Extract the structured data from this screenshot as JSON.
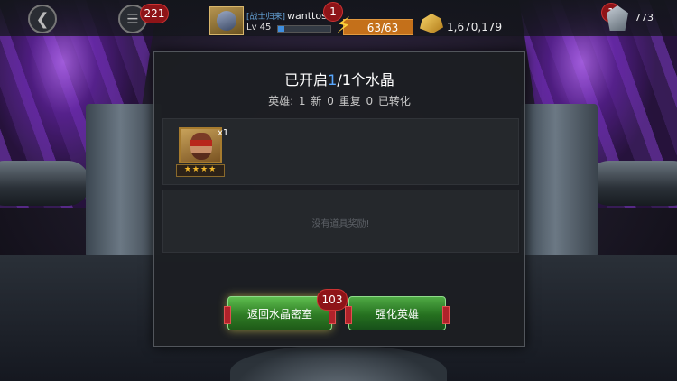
{
  "topbar": {
    "back_icon": "back-arrow-icon",
    "menu_icon": "menu-icon",
    "menu_badge": "221",
    "alliance_tag": "[战士归来]",
    "username": "wanttose",
    "notification_badge": "1",
    "level": "Lv 45",
    "xp_progress": 0.12,
    "energy": "63/63",
    "gold": "1,670,179",
    "units_badge": "1",
    "units": "773"
  },
  "dialog": {
    "title_prefix": "已开启",
    "title_highlight": "1",
    "title_suffix": "/1个水晶",
    "summary": "英雄:  1 新  0 重复  0 已转化",
    "hero": {
      "name_icon": "star-lord-portrait",
      "stars": "★★★★",
      "count": "x1"
    },
    "no_items_text": "没有道具奖励!",
    "back_button": "返回水晶密室",
    "back_badge": "103",
    "power_up_button": "强化英雄"
  },
  "colors": {
    "accent_blue": "#59a8ff",
    "energy_orange": "#c4701a",
    "badge_red": "#8e1418",
    "button_green": "#2e7c25"
  }
}
